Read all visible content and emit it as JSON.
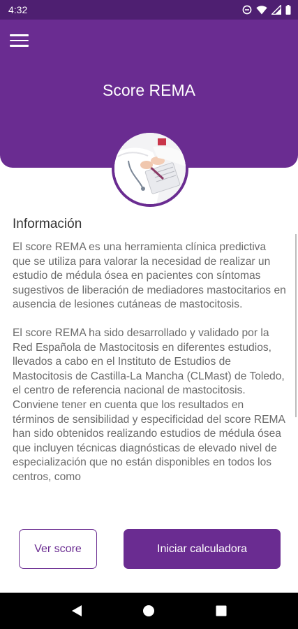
{
  "status_bar": {
    "time": "4:32",
    "icons": [
      "do-not-disturb-icon",
      "wifi-icon",
      "signal-icon",
      "battery-icon"
    ]
  },
  "header": {
    "title": "Score REMA",
    "menu_icon": "hamburger-menu-icon",
    "color": "#6a2c91"
  },
  "content": {
    "section_title": "Información",
    "paragraphs": [
      "El score REMA es una herramienta clínica predictiva que se utiliza para valorar la necesidad de realizar un estudio de médula ósea en pacientes con síntomas sugestivos de liberación de mediadores mastocitarios en ausencia de lesiones cutáneas de mastocitosis.",
      "El score REMA ha sido desarrollado y validado por la Red Española de Mastocitosis en diferentes estudios, llevados a cabo en el Instituto de Estudios de Mastocitosis de Castilla-La Mancha (CLMast) de Toledo, el centro de referencia nacional de mastocitosis. Conviene tener en cuenta que los resultados en términos de sensibilidad y especificidad del score REMA han sido obtenidos realizando estudios de médula ósea que incluyen técnicas diagnósticas de elevado nivel de especialización que no están disponibles en todos los centros, como"
    ]
  },
  "actions": {
    "secondary_label": "Ver score",
    "primary_label": "Iniciar calculadora"
  },
  "nav_bar": {
    "icons": [
      "back-icon",
      "home-icon",
      "recents-icon"
    ]
  }
}
